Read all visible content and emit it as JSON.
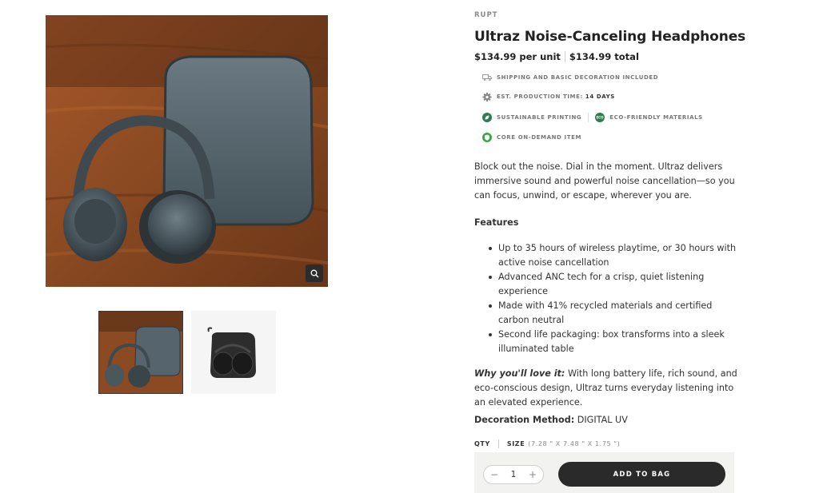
{
  "product": {
    "brand": "RUPT",
    "title": "Ultraz Noise-Canceling Headphones",
    "price_unit": "$134.99 per unit",
    "price_total": "$134.99 total"
  },
  "badges": {
    "shipping": "SHIPPING AND BASIC DECORATION INCLUDED",
    "production_label": "EST. PRODUCTION TIME:",
    "production_value": "14 DAYS",
    "sustainable": "SUSTAINABLE PRINTING",
    "eco": "ECO-FRIENDLY MATERIALS",
    "eco_icon_text": "ECO",
    "core": "CORE ON-DEMAND ITEM"
  },
  "description": "Block out the noise. Dial in the moment. Ultraz delivers immersive sound and powerful noise cancellation—so you can focus, unwind, or escape, wherever you are.",
  "features": {
    "heading": "Features",
    "items": [
      "Up to 35 hours of wireless playtime, or 30 hours with active noise cancellation",
      "Advanced ANC tech for a crisp, quiet listening experience",
      "Made with 41% recycled materials and certified carbon neutral",
      "Second life packaging: box transforms into a sleek illuminated table"
    ]
  },
  "why": {
    "label": "Why you'll love it:",
    "text": " With long battery life, rich sound, and eco-conscious design, Ultraz turns everyday listening into an elevated experience."
  },
  "decoration": {
    "label": "Decoration Method:",
    "value": " DIGITAL UV"
  },
  "options": {
    "qty_label": "QTY",
    "size_label": "SIZE",
    "size_value": "(7.28 \" X 7.48 \" X 1.75 \")"
  },
  "cart": {
    "quantity": "1",
    "minus": "−",
    "plus": "+",
    "add_label": "ADD TO BAG"
  },
  "icons": {
    "shipping": "truck-icon",
    "production": "gear-icon",
    "sustainable": "leaf-icon",
    "eco": "eco-badge-icon",
    "core": "shield-icon",
    "zoom": "magnifier-icon"
  },
  "colors": {
    "button": "#2a2a2a",
    "eco_green": "#2e7d4f",
    "core_green": "#3aa845"
  }
}
